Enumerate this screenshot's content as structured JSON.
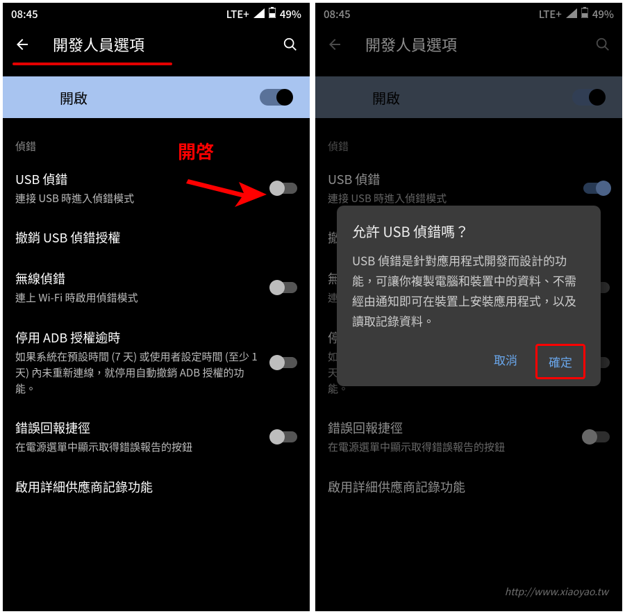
{
  "status": {
    "time": "08:45",
    "lte": "LTE+",
    "battery": "49%"
  },
  "header": {
    "title": "開發人員選項"
  },
  "banner": {
    "label": "開啟"
  },
  "section": {
    "debug": "偵錯"
  },
  "items": {
    "usb_debug": {
      "title": "USB 偵錯",
      "sub": "連接 USB 時進入偵錯模式"
    },
    "revoke": {
      "title": "撤銷 USB 偵錯授權"
    },
    "wireless": {
      "title": "無線偵錯",
      "sub": "連上 Wi-Fi 時啟用偵錯模式"
    },
    "adb_timeout": {
      "title": "停用 ADB 授權逾時",
      "sub": "如果系統在預設時間 (7 天) 或使用者設定時間 (至少 1 天) 內未重新連線，就停用自動撤銷 ADB 授權的功能。"
    },
    "bug_shortcut": {
      "title": "錯誤回報捷徑",
      "sub": "在電源選單中顯示取得錯誤報告的按鈕"
    },
    "verbose_vendor": {
      "title": "啟用詳細供應商記錄功能"
    }
  },
  "annotation": {
    "open": "開啓"
  },
  "dialog": {
    "title": "允許 USB 偵錯嗎？",
    "body": "USB 偵錯是針對應用程式開發而設計的功能，可讓你複製電腦和裝置中的資料、不需經由通知即可在裝置上安裝應用程式，以及讀取記錄資料。",
    "cancel": "取消",
    "confirm": "確定"
  },
  "watermark": "http://www.xiaoyao.tw"
}
